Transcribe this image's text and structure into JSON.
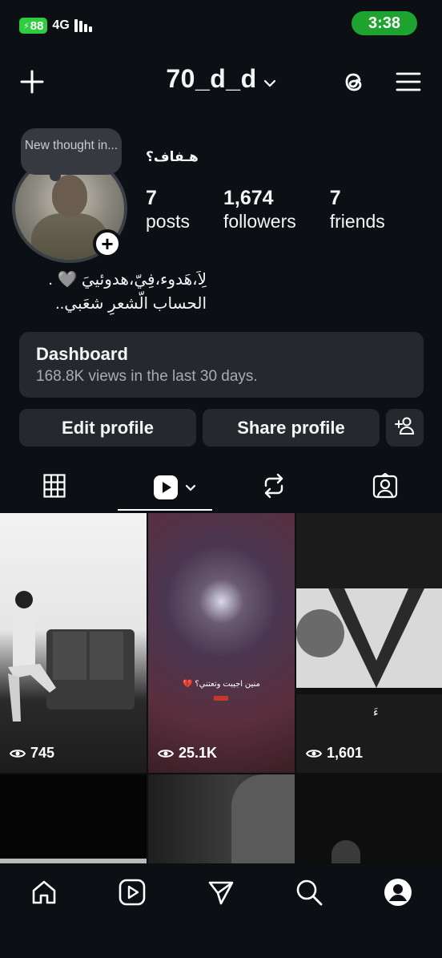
{
  "status_bar": {
    "battery": "88",
    "network": "4G",
    "time": "3:38",
    "time_bg_color": "#1fa32f"
  },
  "header": {
    "username": "70_d_d",
    "icons": [
      "plus-icon",
      "chevron-down-icon",
      "threads-icon",
      "menu-icon"
    ]
  },
  "profile": {
    "thought_bubble": "New thought in...",
    "display_name": "هـفاف؟",
    "stats": [
      {
        "value": "7",
        "label": "posts"
      },
      {
        "value": "1,674",
        "label": "followers"
      },
      {
        "value": "7",
        "label": "friends"
      }
    ],
    "bio_line1": "لِاَ،هَدوء،فِيّ،هدوئييَ 🩶 .",
    "bio_line2": "الحساب الّشعرِ شعَبي.."
  },
  "dashboard": {
    "title": "Dashboard",
    "subtitle": "168.8K views in the last 30 days."
  },
  "buttons": {
    "edit_profile": "Edit profile",
    "share_profile": "Share profile"
  },
  "tabs": [
    "grid-icon",
    "reels-icon",
    "reposts-icon",
    "tagged-icon"
  ],
  "grid": [
    {
      "views": "745"
    },
    {
      "views": "25.1K",
      "caption": "منين اجيبت وتعتني؟ 💔"
    },
    {
      "views": "1,601",
      "overlay": "ءَ"
    },
    {},
    {},
    {}
  ],
  "bottom_nav": [
    "home-icon",
    "reels-icon",
    "send-icon",
    "search-icon",
    "profile-icon"
  ]
}
